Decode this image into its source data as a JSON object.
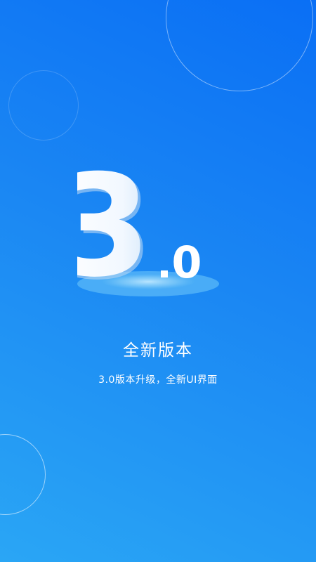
{
  "splash": {
    "version_major": "3",
    "version_minor": "0",
    "title": "全新版本",
    "subtitle": "3.0版本升级，全新UI界面"
  },
  "colors": {
    "background_top": "#0a6ff5",
    "background_bottom": "#2aa6f5",
    "text": "#ffffff",
    "platform_outer": "#58b9f9",
    "platform_inner": "#8fd3fb"
  }
}
